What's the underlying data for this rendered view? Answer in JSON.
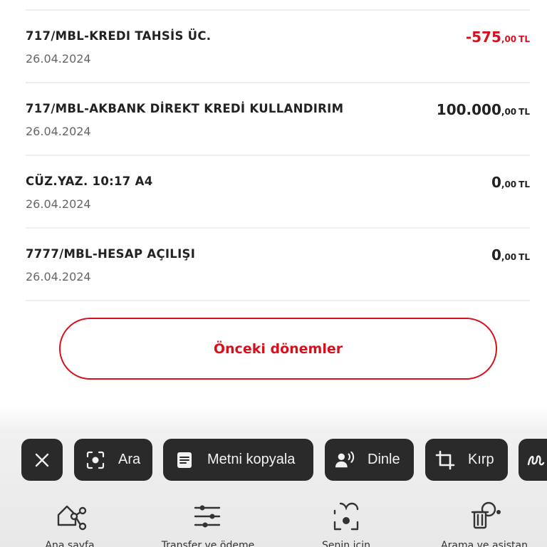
{
  "transactions": [
    {
      "title": "717/MBL-KREDI TAHSİS ÜC.",
      "date": "26.04.2024",
      "int": "-575",
      "dec": ",00",
      "cur": "TL",
      "negative": true
    },
    {
      "title": "717/MBL-AKBANK DİREKT KREDİ KULLANDIRIM",
      "date": "26.04.2024",
      "int": "100.000",
      "dec": ",00",
      "cur": "TL",
      "negative": false
    },
    {
      "title": "CÜZ.YAZ. 10:17 A4",
      "date": "26.04.2024",
      "int": "0",
      "dec": ",00",
      "cur": "TL",
      "negative": false
    },
    {
      "title": "7777/MBL-HESAP AÇILIŞI",
      "date": "26.04.2024",
      "int": "0",
      "dec": ",00",
      "cur": "TL",
      "negative": false
    }
  ],
  "previous_periods_label": "Önceki dönemler",
  "lens_bar": {
    "close_icon": "close-icon",
    "search_label": "Ara",
    "copy_text_label": "Metni kopyala",
    "listen_label": "Dinle",
    "crop_label": "Kırp"
  },
  "nav": {
    "home_label": "Ana sayfa",
    "transfer_label": "Transfer ve ödeme",
    "for_you_label": "Senin için",
    "search_assistant_label": "Arama ve asistan"
  },
  "colors": {
    "accent": "#d6111e",
    "chip_bg": "#2a2a2a"
  }
}
